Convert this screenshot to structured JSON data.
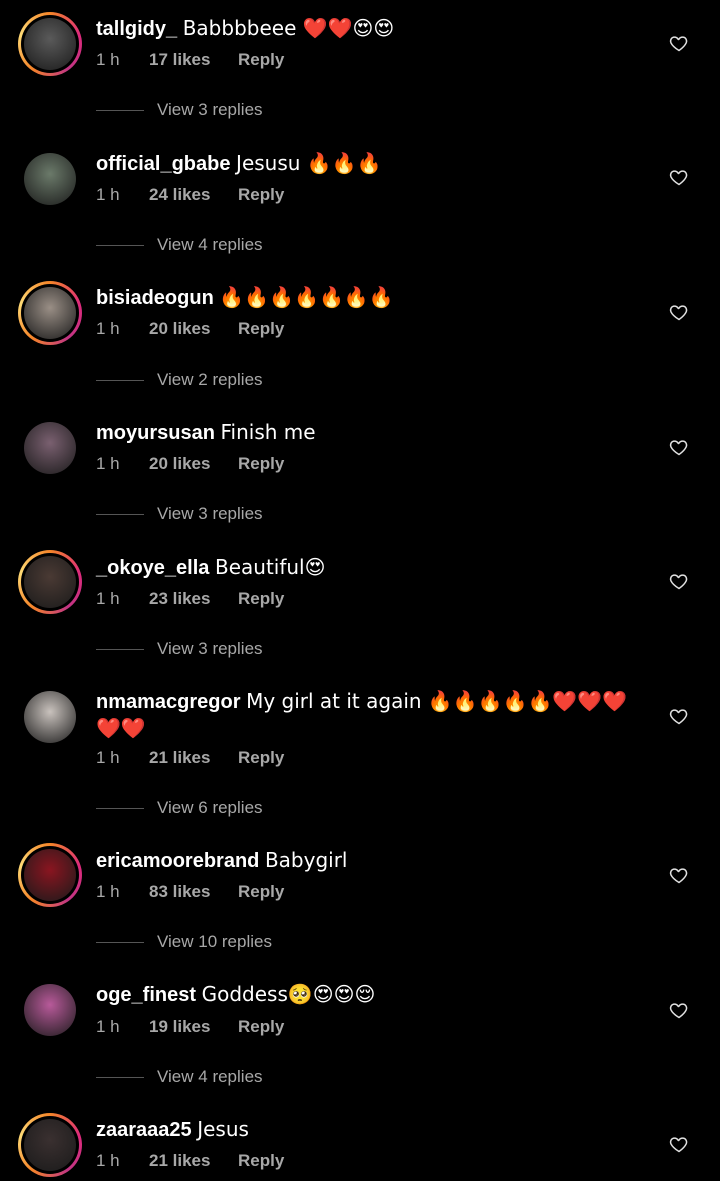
{
  "comments": [
    {
      "username": "tallgidy_",
      "text": "Babbbbeee ❤️❤️😍😍",
      "time": "1 h",
      "likes": "17 likes",
      "reply": "Reply",
      "view_replies": "View 3 replies",
      "story": true,
      "avatar_color": "#5a5a5a"
    },
    {
      "username": "official_gbabe",
      "text": "Jesusu 🔥🔥🔥",
      "time": "1 h",
      "likes": "24 likes",
      "reply": "Reply",
      "view_replies": "View 4 replies",
      "story": false,
      "avatar_color": "#6b7a6a"
    },
    {
      "username": "bisiadeogun",
      "text": "🔥🔥🔥🔥🔥🔥🔥",
      "time": "1 h",
      "likes": "20 likes",
      "reply": "Reply",
      "view_replies": "View 2 replies",
      "story": true,
      "avatar_color": "#9a8f86"
    },
    {
      "username": "moyursusan",
      "text": "Finish me",
      "time": "1 h",
      "likes": "20 likes",
      "reply": "Reply",
      "view_replies": "View 3 replies",
      "story": false,
      "avatar_color": "#7a6070"
    },
    {
      "username": "_okoye_ella",
      "text": "Beautiful😍",
      "time": "1 h",
      "likes": "23 likes",
      "reply": "Reply",
      "view_replies": "View 3 replies",
      "story": true,
      "avatar_color": "#4a3a34"
    },
    {
      "username": "nmamacgregor",
      "text": "My girl at it again 🔥🔥🔥🔥🔥❤️❤️❤️❤️❤️",
      "time": "1 h",
      "likes": "21 likes",
      "reply": "Reply",
      "view_replies": "View 6 replies",
      "story": false,
      "avatar_color": "#c9c2bd"
    },
    {
      "username": "ericamoorebrand",
      "text": "Babygirl",
      "time": "1 h",
      "likes": "83 likes",
      "reply": "Reply",
      "view_replies": "View 10 replies",
      "story": true,
      "avatar_color": "#8a1520"
    },
    {
      "username": "oge_finest",
      "text": "Goddess🥺😍😍😌",
      "time": "1 h",
      "likes": "19 likes",
      "reply": "Reply",
      "view_replies": "View 4 replies",
      "story": false,
      "avatar_color": "#b85a9a"
    },
    {
      "username": "zaaraaa25",
      "text": "Jesus",
      "time": "1 h",
      "likes": "21 likes",
      "reply": "Reply",
      "view_replies": "",
      "story": true,
      "avatar_color": "#3a3030"
    }
  ],
  "heart_icon": "heart-outline-icon",
  "colors": {
    "background": "#000000",
    "text": "#ffffff",
    "secondary": "#a8a8a8"
  }
}
